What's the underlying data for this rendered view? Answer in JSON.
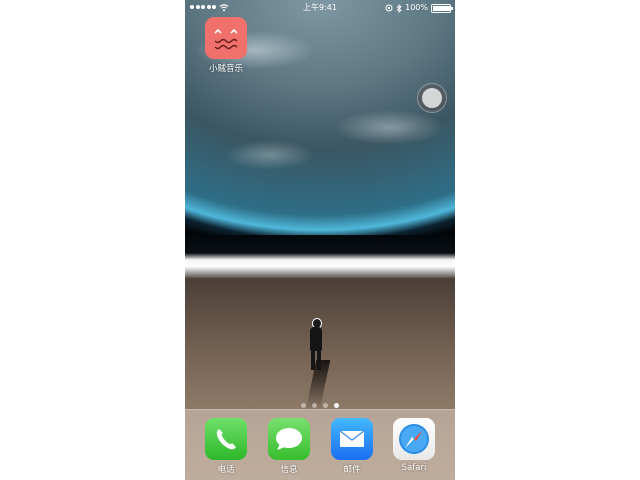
{
  "status_bar": {
    "time": "上午9:41",
    "battery_text": "100%",
    "battery_level": 1.0
  },
  "home": {
    "apps": [
      {
        "label": "小贼音乐",
        "icon": "face-icon"
      }
    ],
    "page_dots": {
      "count": 4,
      "active_index": 3
    }
  },
  "dock": {
    "apps": [
      {
        "label": "电话",
        "icon": "phone-icon"
      },
      {
        "label": "信息",
        "icon": "message-icon"
      },
      {
        "label": "邮件",
        "icon": "mail-icon"
      },
      {
        "label": "Safari",
        "icon": "compass-icon"
      }
    ]
  },
  "colors": {
    "music_icon": "#f0706c",
    "phone_icon": "#3ccf38",
    "mail_icon": "#2a8af7"
  }
}
